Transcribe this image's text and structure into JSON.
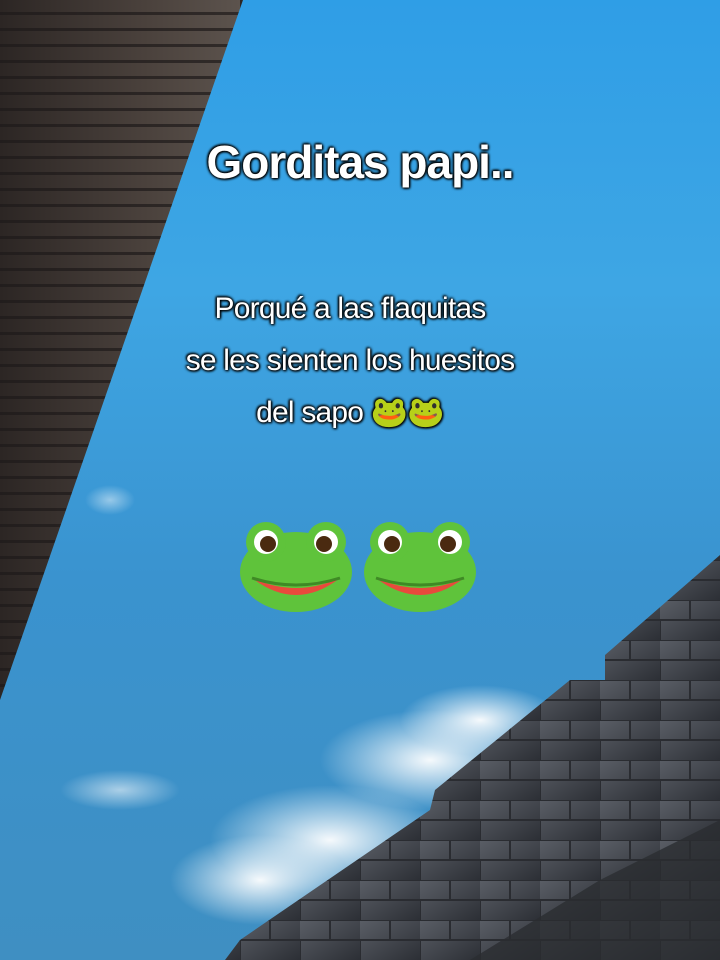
{
  "title": "Gorditas papi..",
  "caption": {
    "line1": "Porqué a las flaquitas",
    "line2": "se les sienten los huesitos",
    "line3": "del sapo 🐸🐸"
  },
  "emoji_large": [
    "frog-face",
    "frog-face"
  ],
  "colors": {
    "sky_top": "#2f9ee6",
    "sky_bottom": "#3f8fc2",
    "frog_green": "#5fc33b",
    "wall_gray": "#4b4f57",
    "wood_dark": "#3a3432"
  }
}
